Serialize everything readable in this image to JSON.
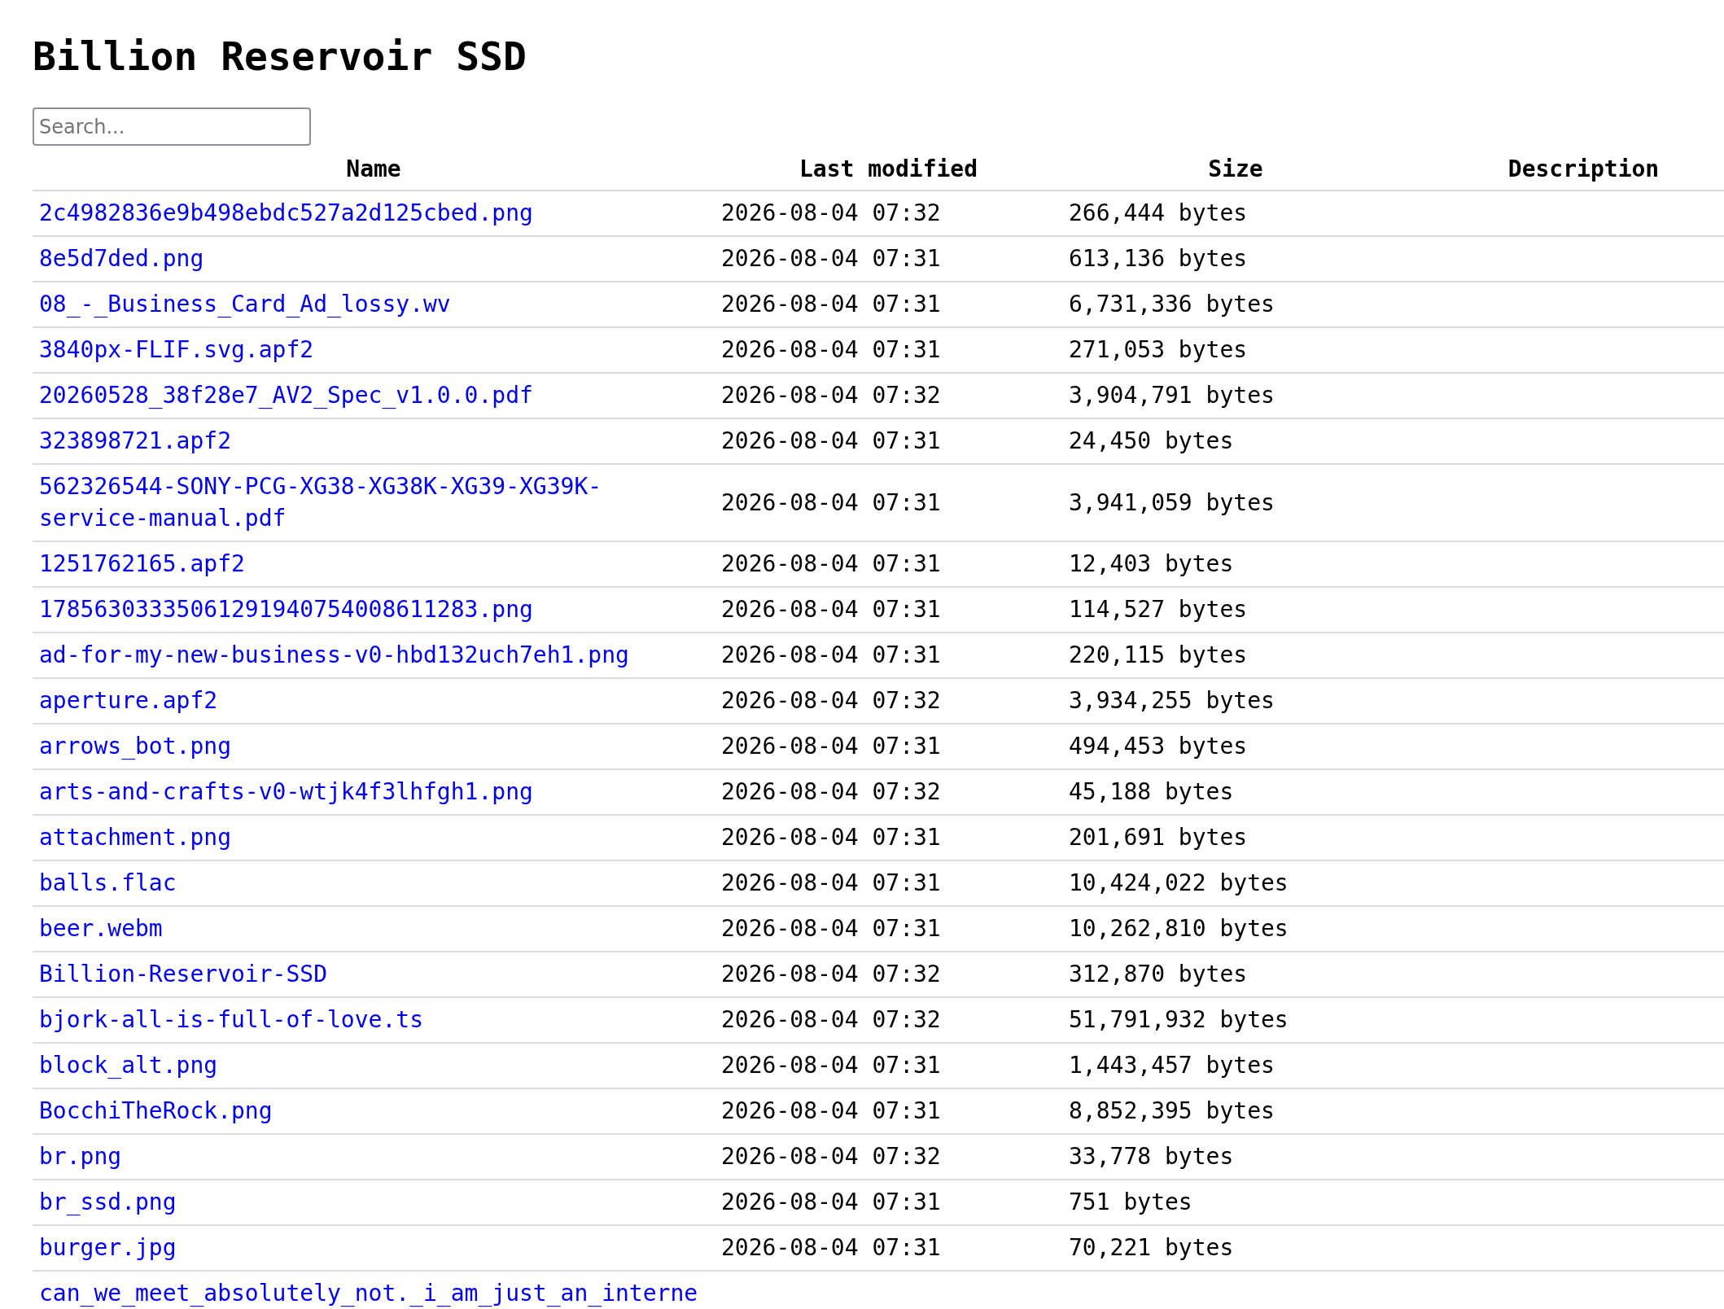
{
  "page": {
    "title": "Billion Reservoir SSD"
  },
  "search": {
    "placeholder": "Search..."
  },
  "table": {
    "columns": [
      "Name",
      "Last modified",
      "Size",
      "Description"
    ],
    "rows": [
      {
        "name": "2c4982836e9b498ebdc527a2d125cbed.png",
        "last_modified": "2026-08-04 07:32",
        "size": "266,444 bytes"
      },
      {
        "name": "8e5d7ded.png",
        "last_modified": "2026-08-04 07:31",
        "size": "613,136 bytes"
      },
      {
        "name": "08_-_Business_Card_Ad_lossy.wv",
        "last_modified": "2026-08-04 07:31",
        "size": "6,731,336 bytes"
      },
      {
        "name": "3840px-FLIF.svg.apf2",
        "last_modified": "2026-08-04 07:31",
        "size": "271,053 bytes"
      },
      {
        "name": "20260528_38f28e7_AV2_Spec_v1.0.0.pdf",
        "last_modified": "2026-08-04 07:32",
        "size": "3,904,791 bytes"
      },
      {
        "name": "323898721.apf2",
        "last_modified": "2026-08-04 07:31",
        "size": "24,450 bytes"
      },
      {
        "name": "562326544-SONY-PCG-XG38-XG38K-XG39-XG39K-service-manual.pdf",
        "last_modified": "2026-08-04 07:31",
        "size": "3,941,059 bytes"
      },
      {
        "name": "1251762165.apf2",
        "last_modified": "2026-08-04 07:31",
        "size": "12,403 bytes"
      },
      {
        "name": "17856303335061291940754008611283.png",
        "last_modified": "2026-08-04 07:31",
        "size": "114,527 bytes"
      },
      {
        "name": "ad-for-my-new-business-v0-hbd132uch7eh1.png",
        "last_modified": "2026-08-04 07:31",
        "size": "220,115 bytes"
      },
      {
        "name": "aperture.apf2",
        "last_modified": "2026-08-04 07:32",
        "size": "3,934,255 bytes"
      },
      {
        "name": "arrows_bot.png",
        "last_modified": "2026-08-04 07:31",
        "size": "494,453 bytes"
      },
      {
        "name": "arts-and-crafts-v0-wtjk4f3lhfgh1.png",
        "last_modified": "2026-08-04 07:32",
        "size": "45,188 bytes"
      },
      {
        "name": "attachment.png",
        "last_modified": "2026-08-04 07:31",
        "size": "201,691 bytes"
      },
      {
        "name": "balls.flac",
        "last_modified": "2026-08-04 07:31",
        "size": "10,424,022 bytes"
      },
      {
        "name": "beer.webm",
        "last_modified": "2026-08-04 07:31",
        "size": "10,262,810 bytes"
      },
      {
        "name": "Billion-Reservoir-SSD",
        "last_modified": "2026-08-04 07:32",
        "size": "312,870 bytes"
      },
      {
        "name": "bjork-all-is-full-of-love.ts",
        "last_modified": "2026-08-04 07:32",
        "size": "51,791,932 bytes"
      },
      {
        "name": "block_alt.png",
        "last_modified": "2026-08-04 07:31",
        "size": "1,443,457 bytes"
      },
      {
        "name": "BocchiTheRock.png",
        "last_modified": "2026-08-04 07:31",
        "size": "8,852,395 bytes"
      },
      {
        "name": "br.png",
        "last_modified": "2026-08-04 07:32",
        "size": "33,778 bytes"
      },
      {
        "name": "br_ssd.png",
        "last_modified": "2026-08-04 07:31",
        "size": "751 bytes"
      },
      {
        "name": "burger.jpg",
        "last_modified": "2026-08-04 07:31",
        "size": "70,221 bytes"
      },
      {
        "name": "can_we_meet_absolutely_not._i_am_just_an_interne"
      }
    ]
  }
}
